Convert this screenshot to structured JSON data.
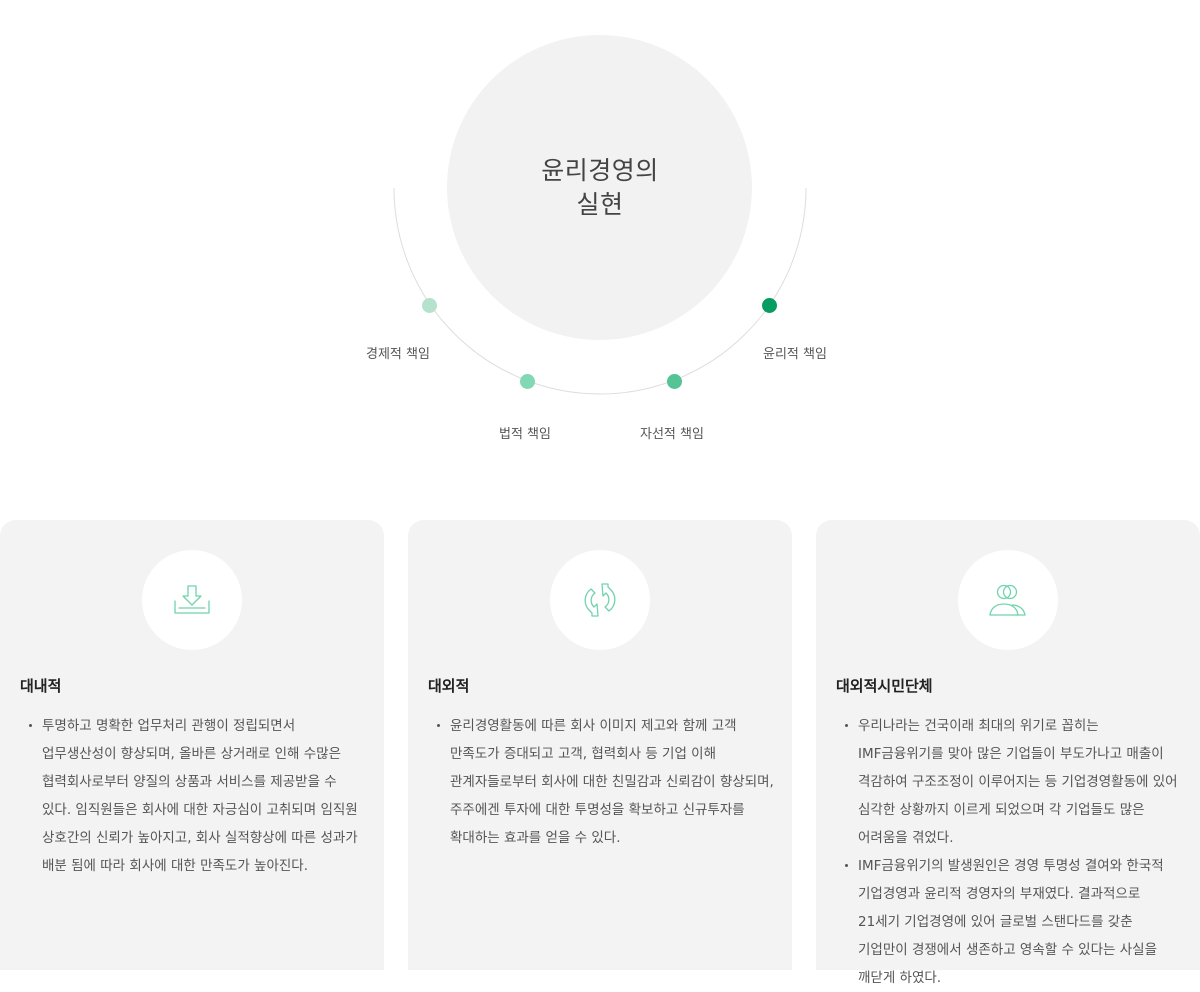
{
  "diagram": {
    "center_line1": "윤리경영의",
    "center_line2": "실현",
    "labels": [
      "경제적 책임",
      "법적 책임",
      "자선적 책임",
      "윤리적 책임"
    ],
    "dot_colors": [
      "#b4e2cd",
      "#82d8b4",
      "#54c395",
      "#079d62"
    ]
  },
  "cards": [
    {
      "icon": "download-tray-icon",
      "title": "대내적",
      "items": [
        "투명하고 명확한 업무처리 관행이 정립되면서 업무생산성이 향상되며, 올바른 상거래로 인해 수많은 협력회사로부터 양질의 상품과 서비스를 제공받을 수 있다. 임직원들은 회사에 대한 자긍심이 고취되며 임직원 상호간의 신뢰가 높아지고, 회사 실적향상에 따른 성과가 배분 됨에 따라 회사에 대한 만족도가 높아진다."
      ]
    },
    {
      "icon": "refresh-arrows-icon",
      "title": "대외적",
      "items": [
        "윤리경영활동에 따른 회사 이미지 제고와 함께 고객 만족도가 증대되고 고객, 협력회사 등 기업 이해 관계자들로부터 회사에 대한 친밀감과 신뢰감이 향상되며, 주주에겐 투자에 대한 투명성을 확보하고 신규투자를 확대하는 효과를 얻을 수 있다."
      ]
    },
    {
      "icon": "users-icon",
      "title": "대외적시민단체",
      "items": [
        "우리나라는 건국이래 최대의 위기로 꼽히는 IMF금융위기를 맞아 많은 기업들이 부도가나고 매출이 격감하여 구조조정이 이루어지는 등 기업경영활동에 있어 심각한 상황까지 이르게 되었으며 각 기업들도 많은 어려움을 겪었다.",
        "IMF금융위기의 발생원인은 경영 투명성 결여와 한국적 기업경영과 윤리적 경영자의 부재였다. 결과적으로 21세기 기업경영에 있어 글로벌 스탠다드를 갖춘 기업만이 경쟁에서 생존하고 영속할 수 있다는 사실을 깨닫게 하였다."
      ]
    }
  ]
}
